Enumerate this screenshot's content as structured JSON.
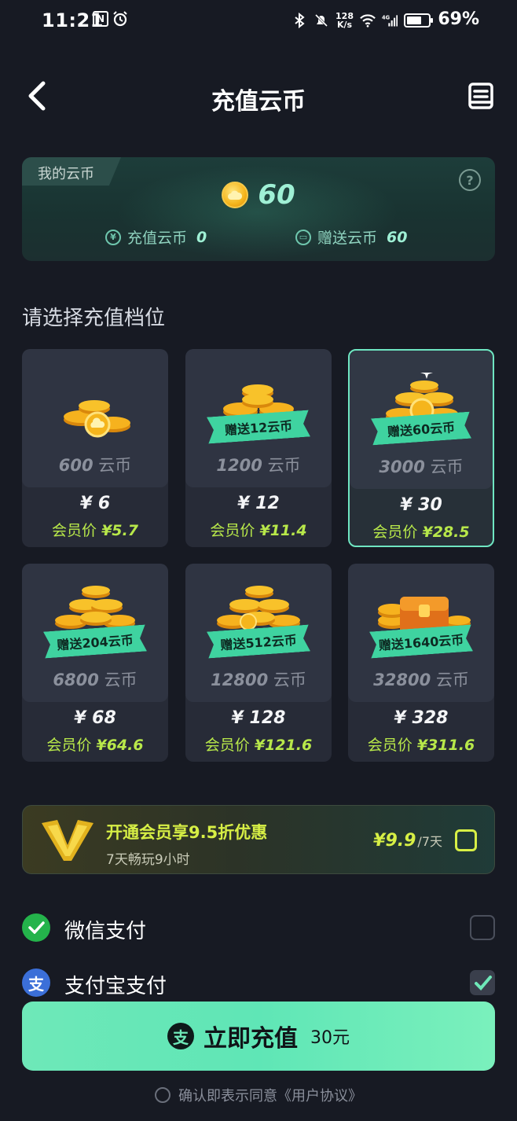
{
  "status_bar": {
    "time": "11:21",
    "net_speed_top": "128",
    "net_speed_bottom": "K/s",
    "network_type": "4G",
    "battery": "69%",
    "battery_level": 0.69,
    "icons": [
      "nfc-icon",
      "alarm-icon",
      "bluetooth-icon",
      "mute-icon",
      "wifi-icon",
      "signal-icon",
      "battery-icon"
    ]
  },
  "header": {
    "title": "充值云币",
    "back_icon": "chevron-left-icon",
    "record_icon": "record-book-icon"
  },
  "balance": {
    "tag": "我的云币",
    "total": "60",
    "recharge_label": "充值云币",
    "recharge_value": "0",
    "gift_label": "赠送云币",
    "gift_value": "60",
    "help": "?"
  },
  "section_title": "请选择充值档位",
  "packages": [
    {
      "amount": "600",
      "unit": "云币",
      "price": "¥ 6",
      "member_label": "会员价",
      "member_price": "¥5.7",
      "bonus": "",
      "selected": false
    },
    {
      "amount": "1200",
      "unit": "云币",
      "price": "¥ 12",
      "member_label": "会员价",
      "member_price": "¥11.4",
      "bonus": "赠送12云币",
      "selected": false
    },
    {
      "amount": "3000",
      "unit": "云币",
      "price": "¥ 30",
      "member_label": "会员价",
      "member_price": "¥28.5",
      "bonus": "赠送60云币",
      "selected": true
    },
    {
      "amount": "6800",
      "unit": "云币",
      "price": "¥ 68",
      "member_label": "会员价",
      "member_price": "¥64.6",
      "bonus": "赠送204云币",
      "selected": false
    },
    {
      "amount": "12800",
      "unit": "云币",
      "price": "¥ 128",
      "member_label": "会员价",
      "member_price": "¥121.6",
      "bonus": "赠送512云币",
      "selected": false
    },
    {
      "amount": "32800",
      "unit": "云币",
      "price": "¥ 328",
      "member_label": "会员价",
      "member_price": "¥311.6",
      "bonus": "赠送1640云币",
      "selected": false
    }
  ],
  "vip": {
    "title": "开通会员享9.5折优惠",
    "subtitle": "7天畅玩9小时",
    "price": "¥9.9",
    "unit": "/7天"
  },
  "payment": [
    {
      "label": "微信支付",
      "icon": "wechat-pay-icon",
      "checked": false
    },
    {
      "label": "支付宝支付",
      "icon": "alipay-icon",
      "checked": true
    }
  ],
  "recharge": {
    "label": "立即充值",
    "amount": "30元"
  },
  "agreement": "确认即表示同意《用户协议》",
  "colors": {
    "accent": "#6ee8b8",
    "member": "#b8e84a",
    "background": "#171a23"
  }
}
